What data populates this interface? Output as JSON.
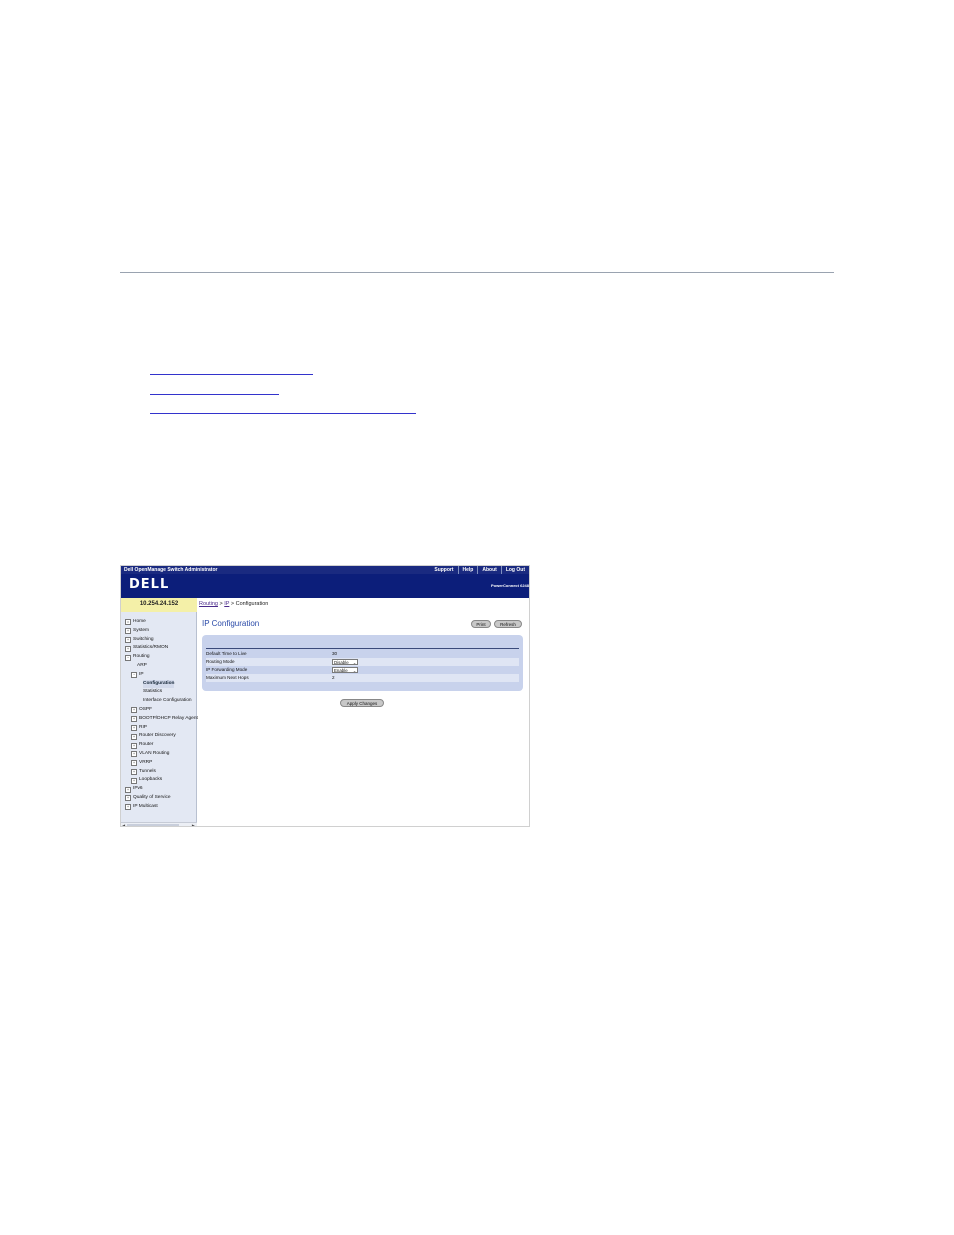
{
  "document": {
    "links": [
      {
        "label": ""
      },
      {
        "label": ""
      },
      {
        "label": ""
      }
    ]
  },
  "app": {
    "title": "Dell OpenManage Switch Administrator",
    "nav": [
      "Support",
      "Help",
      "About",
      "Log Out"
    ],
    "logo": "DELL",
    "product": "PowerConnect 6248",
    "ip_address": "10.254.24.152"
  },
  "sidebar": {
    "items": [
      {
        "label": "Home",
        "icon": "home-icon"
      },
      {
        "label": "System",
        "icon": "expand-icon"
      },
      {
        "label": "Switching",
        "icon": "expand-icon"
      },
      {
        "label": "Statistics/RMON",
        "icon": "expand-icon"
      },
      {
        "label": "Routing",
        "icon": "collapse-icon"
      },
      {
        "label": "ARP"
      },
      {
        "label": "IP",
        "icon": "collapse-icon"
      },
      {
        "label": "Configuration",
        "selected": true
      },
      {
        "label": "Statistics"
      },
      {
        "label": "Interface Configuration"
      },
      {
        "label": "OSPF",
        "icon": "expand-icon"
      },
      {
        "label": "BOOTP/DHCP Relay Agent",
        "icon": "expand-icon"
      },
      {
        "label": "RIP",
        "icon": "expand-icon"
      },
      {
        "label": "Router Discovery",
        "icon": "expand-icon"
      },
      {
        "label": "Router",
        "icon": "expand-icon"
      },
      {
        "label": "VLAN Routing",
        "icon": "expand-icon"
      },
      {
        "label": "VRRP",
        "icon": "expand-icon"
      },
      {
        "label": "Tunnels",
        "icon": "expand-icon"
      },
      {
        "label": "Loopbacks",
        "icon": "expand-icon"
      },
      {
        "label": "IPv6",
        "icon": "expand-icon"
      },
      {
        "label": "Quality of Service",
        "icon": "expand-icon"
      },
      {
        "label": "IP Multicast",
        "icon": "expand-icon"
      }
    ]
  },
  "breadcrumb": {
    "routing": "Routing",
    "sep1": " > ",
    "ip": "IP",
    "sep2": " > ",
    "current": "Configuration"
  },
  "page": {
    "title": "IP Configuration",
    "print_label": "Print",
    "refresh_label": "Refresh",
    "apply_label": "Apply Changes"
  },
  "form": {
    "default_ttl": {
      "label": "Default Time to Live",
      "value": "30"
    },
    "routing_mode": {
      "label": "Routing Mode",
      "value": "Disable"
    },
    "ip_forwarding_mode": {
      "label": "IP Forwarding Mode",
      "value": "Enable"
    },
    "max_next_hops": {
      "label": "Maximum Next Hops",
      "value": "2"
    }
  },
  "colors": {
    "banner": "#0c1e7a",
    "panel": "#c8d2ec",
    "ip_box": "#f4f0a8",
    "title": "#2a4aa8"
  }
}
